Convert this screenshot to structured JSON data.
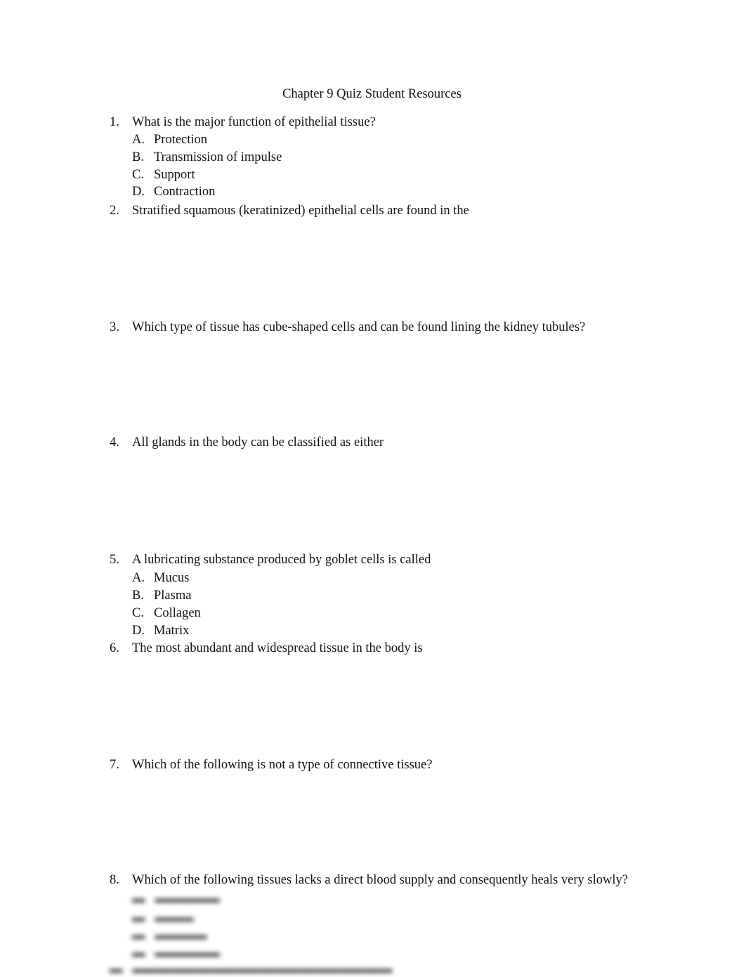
{
  "document": {
    "title": "Chapter 9 Quiz Student Resources",
    "questions": [
      {
        "number": "1.",
        "text": "What is the major function of epithelial tissue?",
        "options": [
          {
            "letter": "A.",
            "text": "Protection"
          },
          {
            "letter": "B.",
            "text": "Transmission of impulse"
          },
          {
            "letter": "C.",
            "text": "Support"
          },
          {
            "letter": "D.",
            "text": "Contraction"
          }
        ]
      },
      {
        "number": "2.",
        "text": "Stratified squamous (keratinized) epithelial cells are found in the"
      },
      {
        "number": "3.",
        "text": "Which type of tissue has cube-shaped cells and can be found lining the kidney tubules?"
      },
      {
        "number": "4.",
        "text": "All glands in the body can be classified as either"
      },
      {
        "number": "5.",
        "text": "A lubricating substance produced by goblet cells is called",
        "options": [
          {
            "letter": "A.",
            "text": "Mucus"
          },
          {
            "letter": "B.",
            "text": "Plasma"
          },
          {
            "letter": "C.",
            "text": "Collagen"
          },
          {
            "letter": "D.",
            "text": "Matrix"
          }
        ]
      },
      {
        "number": "6.",
        "text": "The most abundant and widespread tissue in the body is"
      },
      {
        "number": "7.",
        "text": "Which of the following is not a type of connective tissue?"
      },
      {
        "number": "8.",
        "text": "Which of the following tissues lacks a direct blood supply and consequently heals very slowly?"
      }
    ]
  }
}
